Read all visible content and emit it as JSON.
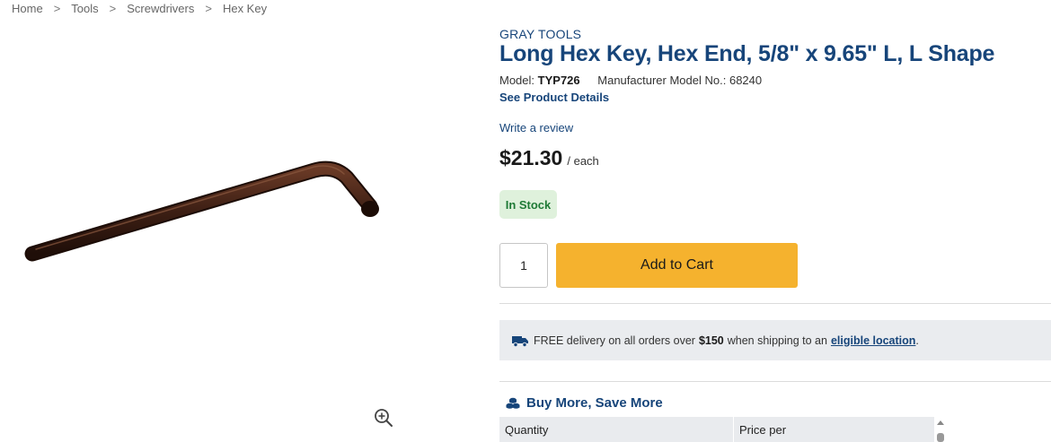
{
  "breadcrumb": {
    "items": [
      "Home",
      "Tools",
      "Screwdrivers",
      "Hex Key"
    ],
    "separator": ">"
  },
  "product": {
    "brand": "GRAY TOOLS",
    "title": "Long Hex Key, Hex End, 5/8\" x 9.65\" L, L Shape",
    "model_label": "Model:",
    "model_value": "TYP726",
    "mfr_label": "Manufacturer Model No.:",
    "mfr_value": "68240",
    "details_link": "See Product Details",
    "review_link": "Write a review",
    "price": "$21.30",
    "unit": "/ each",
    "stock_status": "In Stock",
    "image_icon": "hex-key-product-image"
  },
  "cart": {
    "quantity": "1",
    "add_label": "Add to Cart"
  },
  "delivery": {
    "icon": "truck-icon",
    "text_before": "FREE delivery on all orders over",
    "threshold": "$150",
    "text_middle": "when shipping to an",
    "link": "eligible location",
    "text_after": "."
  },
  "bulk": {
    "icon": "coins-icon",
    "title": "Buy More, Save More",
    "columns": [
      "Quantity",
      "Price per"
    ]
  },
  "colors": {
    "brand_blue": "#17457a",
    "cart_yellow": "#f5b22e",
    "stock_green": "#1f7a36",
    "stock_bg": "#dff1dc",
    "banner_bg": "#eaecef"
  }
}
